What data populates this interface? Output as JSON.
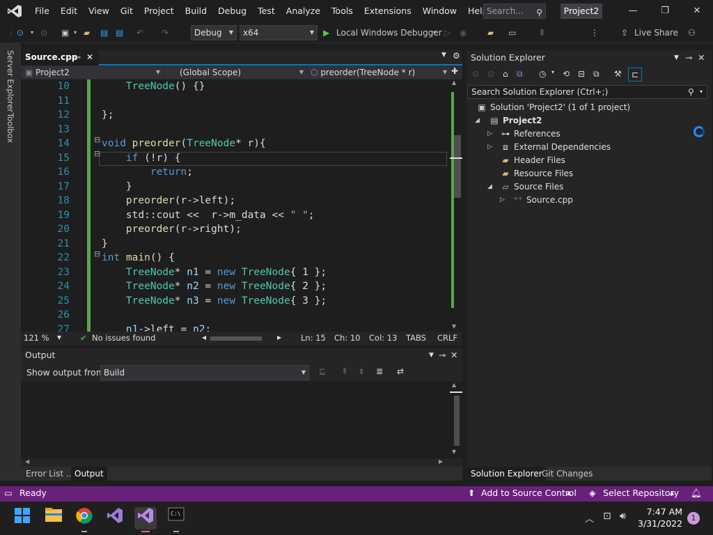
{
  "menu": {
    "items": [
      "File",
      "Edit",
      "View",
      "Git",
      "Project",
      "Build",
      "Debug",
      "Test",
      "Analyze",
      "Tools",
      "Extensions",
      "Window",
      "Help"
    ],
    "search_placeholder": "Search...",
    "project_badge": "Project2"
  },
  "toolbar": {
    "config": "Debug",
    "platform": "x64",
    "run_label": "Local Windows Debugger",
    "live_share": "Live Share"
  },
  "left_tabs": [
    "Server Explorer",
    "Toolbox"
  ],
  "editor": {
    "tab_title": "Source.cpp",
    "nav": {
      "project": "Project2",
      "scope": "(Global Scope)",
      "member": "preorder(TreeNode * r)"
    },
    "status": {
      "zoom": "121 %",
      "issues": "No issues found",
      "line": "Ln: 15",
      "char": "Ch: 10",
      "col": "Col: 13",
      "tabs": "TABS",
      "eol": "CRLF"
    }
  },
  "code_lines": [
    {
      "n": "10",
      "t": "    TreeNode() {}"
    },
    {
      "n": "11",
      "t": ""
    },
    {
      "n": "12",
      "t": "};"
    },
    {
      "n": "13",
      "t": ""
    },
    {
      "n": "14",
      "t": "void preorder(TreeNode* r){"
    },
    {
      "n": "15",
      "t": "    if (!r) {"
    },
    {
      "n": "16",
      "t": "        return;"
    },
    {
      "n": "17",
      "t": "    }"
    },
    {
      "n": "18",
      "t": "    preorder(r->left);"
    },
    {
      "n": "19",
      "t": "    std::cout <<  r->m_data << \" \";"
    },
    {
      "n": "20",
      "t": "    preorder(r->right);"
    },
    {
      "n": "21",
      "t": "}"
    },
    {
      "n": "22",
      "t": "int main() {"
    },
    {
      "n": "23",
      "t": "    TreeNode* n1 = new TreeNode{ 1 };"
    },
    {
      "n": "24",
      "t": "    TreeNode* n2 = new TreeNode{ 2 };"
    },
    {
      "n": "25",
      "t": "    TreeNode* n3 = new TreeNode{ 3 };"
    },
    {
      "n": "26",
      "t": ""
    },
    {
      "n": "27",
      "t": "    n1->left = n2;"
    }
  ],
  "output": {
    "title": "Output",
    "show_from_label": "Show output from:",
    "source": "Build",
    "tabs": [
      "Error List ...",
      "Output"
    ]
  },
  "solution_explorer": {
    "title": "Solution Explorer",
    "search_placeholder": "Search Solution Explorer (Ctrl+;)",
    "solution": "Solution 'Project2' (1 of 1 project)",
    "project": "Project2",
    "nodes": [
      "References",
      "External Dependencies",
      "Header Files",
      "Resource Files",
      "Source Files"
    ],
    "file": "Source.cpp",
    "tabs": [
      "Solution Explorer",
      "Git Changes"
    ]
  },
  "statusbar": {
    "ready": "Ready",
    "source_control": "Add to Source Control",
    "repo": "Select Repository",
    "notif_count": "1"
  },
  "taskbar": {
    "time": "7:47 AM",
    "date": "3/31/2022"
  },
  "colors": {
    "accent": "#007acc",
    "status": "#68217a",
    "change_bar": "#57a64a"
  }
}
